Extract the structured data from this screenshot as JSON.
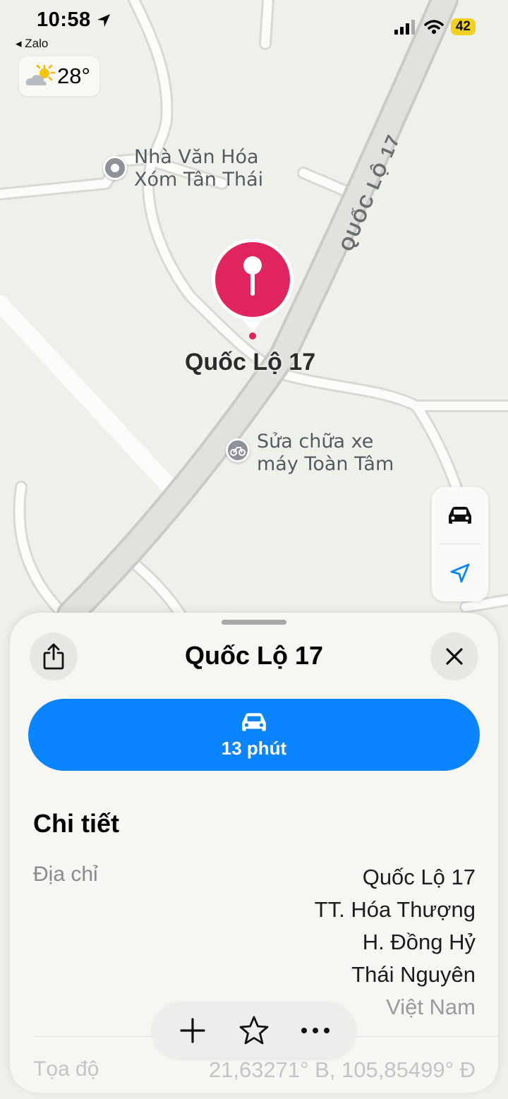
{
  "status_bar": {
    "time": "10:58",
    "back_app": "◂ Zalo",
    "battery": "42"
  },
  "weather": {
    "temperature": "28°",
    "icon": "partly-sunny-icon"
  },
  "map": {
    "pois": [
      {
        "name_line1": "Nhà Văn Hóa",
        "name_line2": "Xóm Tân Thái",
        "icon": "place-icon"
      },
      {
        "name_line1": "Sửa chữa xe",
        "name_line2": "máy Toàn Tâm",
        "icon": "motorbike-repair-icon"
      }
    ],
    "road_label": "QUỐC LỘ 17",
    "pin_label": "Quốc Lộ 17",
    "controls": [
      {
        "icon": "car-icon"
      },
      {
        "icon": "location-arrow-icon"
      }
    ]
  },
  "sheet": {
    "title": "Quốc Lộ 17",
    "route_time": "13 phút",
    "section_title": "Chi tiết",
    "address_key": "Địa chỉ",
    "address_lines": [
      "Quốc Lộ 17",
      "TT. Hóa Thượng",
      "H. Đồng Hỷ",
      "Thái Nguyên",
      "Việt Nam"
    ],
    "coord_key": "Tọa độ",
    "coord_value": "21,63271° B, 105,85499° Đ"
  },
  "actions": [
    {
      "icon": "plus-icon"
    },
    {
      "icon": "star-icon"
    },
    {
      "icon": "more-icon"
    }
  ],
  "colors": {
    "accent": "#0a84ff",
    "pin": "#e0245e",
    "battery": "#f1d020"
  }
}
